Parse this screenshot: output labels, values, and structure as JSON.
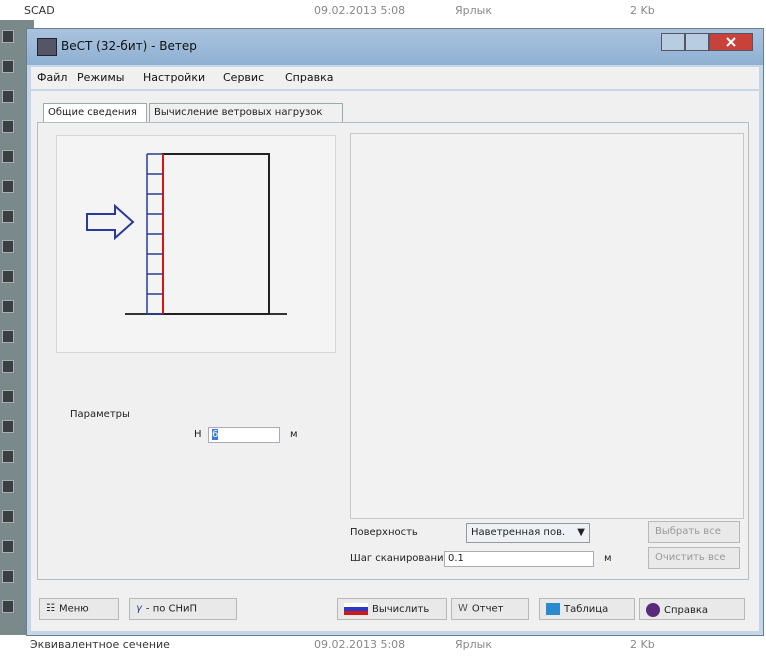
{
  "background": {
    "top_row": {
      "name": "SCAD",
      "date": "09.02.2013 5:08",
      "type": "Ярлык",
      "size": "2 Kb"
    },
    "bottom_row": {
      "name": "Эквивалентное сечение",
      "date": "09.02.2013 5:08",
      "type": "Ярлык",
      "size": "2 Kb"
    }
  },
  "window": {
    "title": "ВеСТ (32-бит) - Ветер"
  },
  "menu": [
    "Файл",
    "Режимы",
    "Настройки",
    "Сервис",
    "Справка"
  ],
  "tabs": [
    "Общие сведения",
    "Вычисление ветровых нагрузок"
  ],
  "params": {
    "label": "Параметры",
    "h_label": "H",
    "h_value": "6",
    "h_unit": "м"
  },
  "surface": {
    "label": "Поверхность",
    "selected": "Наветренная пов."
  },
  "scan": {
    "label": "Шаг сканирования",
    "value": "0.1",
    "unit": "м"
  },
  "buttons": {
    "select_all": "Выбрать все",
    "clear_all": "Очистить все",
    "menu": "Меню",
    "snip": "- по СНиП",
    "gamma": "γ",
    "calc": "Вычислить",
    "report": "Отчет",
    "table": "Таблица",
    "help": "Справка"
  },
  "colors": {
    "accent_red": "#d01818",
    "diagram_blue": "#2a3a9a",
    "window_frame": "#c7d6e6"
  }
}
